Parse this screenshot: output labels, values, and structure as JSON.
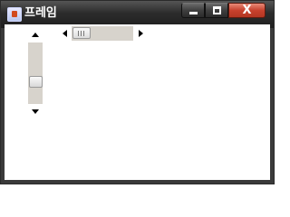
{
  "window": {
    "title": "프레임",
    "app_icon": "java-cup-icon",
    "controls": {
      "minimize_icon": "minimize-icon",
      "maximize_icon": "maximize-icon",
      "close_label": "X",
      "close_color": "#c8412d"
    }
  },
  "vertical_scrollbar": {
    "value_fraction": 0.5,
    "up_icon": "arrow-up-icon",
    "down_icon": "arrow-down-icon"
  },
  "horizontal_scrollbar": {
    "value_fraction": 0.0,
    "left_icon": "arrow-left-icon",
    "right_icon": "arrow-right-icon"
  },
  "colors": {
    "scroll_track": "#d7d3cc",
    "client_background": "#ffffff"
  }
}
